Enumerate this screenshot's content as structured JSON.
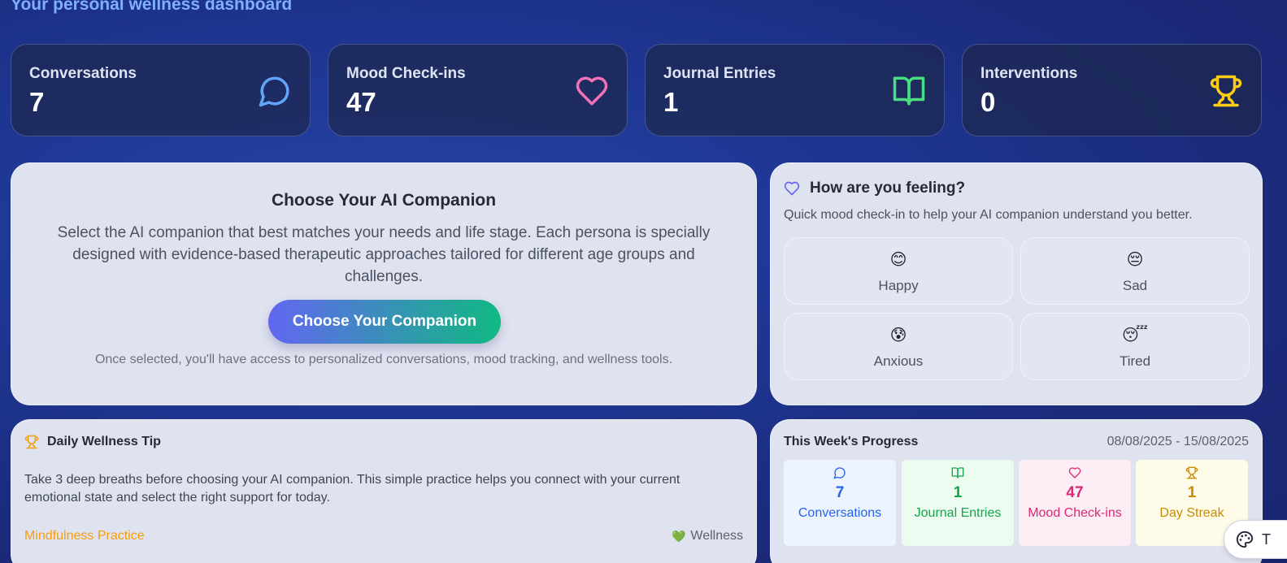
{
  "header": {
    "subtitle": "Your personal wellness dashboard"
  },
  "stats": [
    {
      "label": "Conversations",
      "value": "7",
      "icon": "chat-bubble-icon",
      "color": "#60a5fa"
    },
    {
      "label": "Mood Check-ins",
      "value": "47",
      "icon": "heart-icon",
      "color": "#f472b6"
    },
    {
      "label": "Journal Entries",
      "value": "1",
      "icon": "book-icon",
      "color": "#4ade80"
    },
    {
      "label": "Interventions",
      "value": "0",
      "icon": "trophy-icon",
      "color": "#facc15"
    }
  ],
  "companion": {
    "title": "Choose Your AI Companion",
    "description": "Select the AI companion that best matches your needs and life stage. Each persona is specially designed with evidence-based therapeutic approaches tailored for different age groups and challenges.",
    "button_label": "Choose Your Companion",
    "note": "Once selected, you'll have access to personalized conversations, mood tracking, and wellness tools."
  },
  "mood": {
    "title": "How are you feeling?",
    "subtitle": "Quick mood check-in to help your AI companion understand you better.",
    "options": [
      {
        "emoji": "😊",
        "label": "Happy"
      },
      {
        "emoji": "😔",
        "label": "Sad"
      },
      {
        "emoji": "😰",
        "label": "Anxious"
      },
      {
        "emoji": "😴",
        "label": "Tired"
      }
    ]
  },
  "tip": {
    "title": "Daily Wellness Tip",
    "text": "Take 3 deep breaths before choosing your AI companion. This simple practice helps you connect with your current emotional state and select the right support for today.",
    "category": "Mindfulness Practice",
    "tag": "Wellness",
    "tag_emoji": "💚"
  },
  "progress": {
    "title": "This Week's Progress",
    "date_range": "08/08/2025 - 15/08/2025",
    "items": [
      {
        "value": "7",
        "label": "Conversations",
        "icon": "chat-bubble-icon",
        "color": "#2563eb",
        "bg": "#eef4fe"
      },
      {
        "value": "1",
        "label": "Journal Entries",
        "icon": "book-icon",
        "color": "#16a34a",
        "bg": "#ecfcf1"
      },
      {
        "value": "47",
        "label": "Mood Check-ins",
        "icon": "heart-icon",
        "color": "#db2777",
        "bg": "#fdeef5"
      },
      {
        "value": "1",
        "label": "Day Streak",
        "icon": "trophy-icon",
        "color": "#ca8a04",
        "bg": "#fefbe8"
      }
    ]
  },
  "theme_toggle": {
    "label": "T",
    "icon": "palette-icon"
  }
}
